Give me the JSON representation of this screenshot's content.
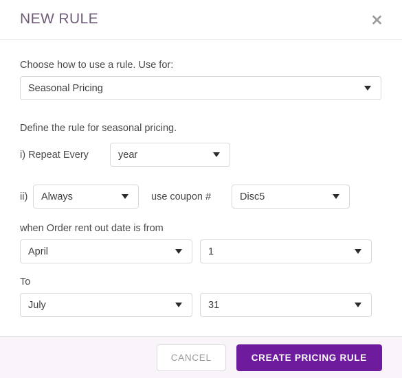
{
  "header": {
    "title": "NEW RULE",
    "close_icon": "close-icon"
  },
  "body": {
    "rule_type": {
      "label": "Choose how to use a rule. Use for:",
      "value": "Seasonal Pricing"
    },
    "define_label": "Define the rule for seasonal pricing.",
    "repeat": {
      "prefix_label": "i) Repeat Every",
      "value": "year"
    },
    "coupon": {
      "prefix_label": "ii)",
      "condition_value": "Always",
      "middle_label": "use coupon #",
      "coupon_value": "Disc5"
    },
    "from": {
      "label": "when Order rent out date is from",
      "month_value": "April",
      "day_value": "1"
    },
    "to": {
      "label": "To",
      "month_value": "July",
      "day_value": "31"
    }
  },
  "footer": {
    "cancel_label": "CANCEL",
    "submit_label": "CREATE PRICING RULE"
  },
  "colors": {
    "title": "#6f5d78",
    "primary": "#6f1b9e",
    "footer_bg": "#f8f4f9",
    "border": "#d8d8d8",
    "text": "#4a4a4a"
  }
}
